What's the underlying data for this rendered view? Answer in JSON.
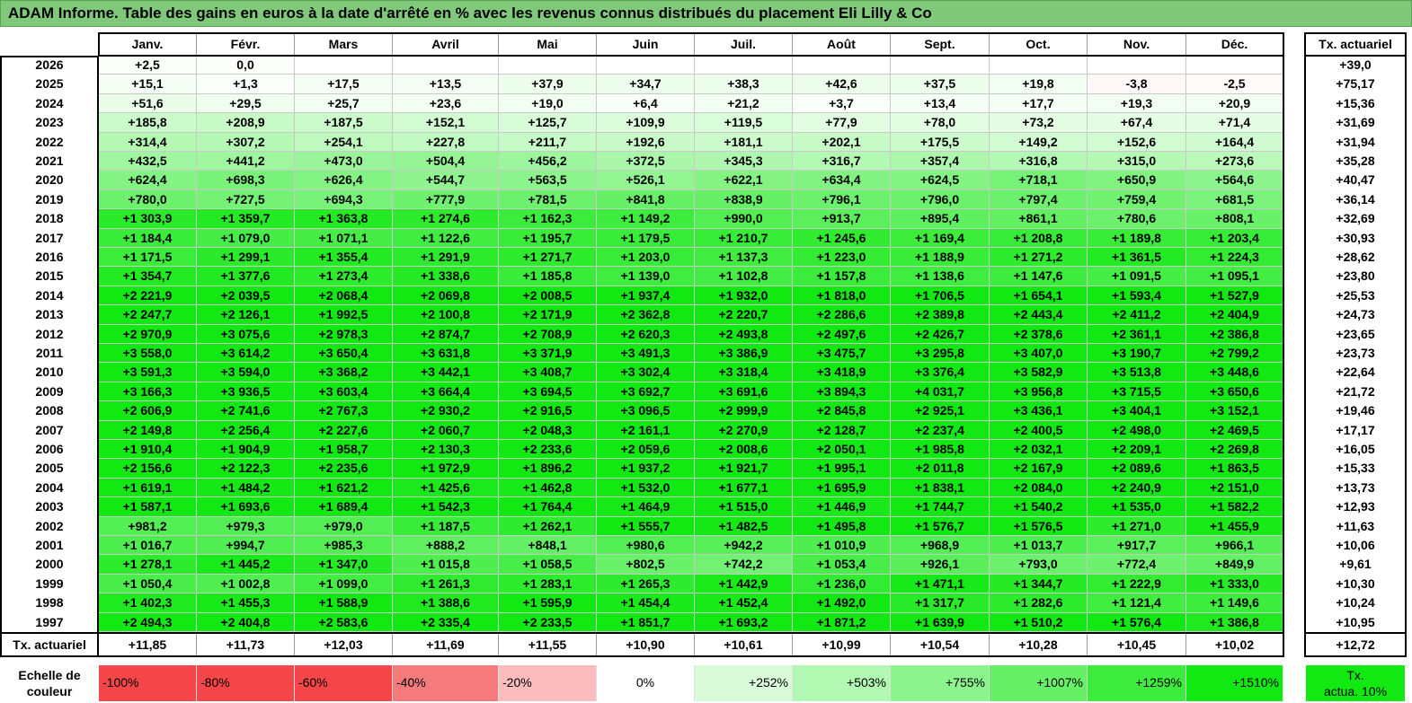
{
  "title": "ADAM Informe. Table des gains en euros à la date d'arrêté en % avec les revenus connus distribués du placement Eli Lilly & Co",
  "months": [
    "Janv.",
    "Févr.",
    "Mars",
    "Avril",
    "Mai",
    "Juin",
    "Juil.",
    "Août",
    "Sept.",
    "Oct.",
    "Nov.",
    "Déc."
  ],
  "rate_header": "Tx. actuariel",
  "rows": [
    {
      "year": "2026",
      "values": [
        "+2,5",
        "0,0",
        "",
        "",
        "",
        "",
        "",
        "",
        "",
        "",
        "",
        ""
      ],
      "rate": "+39,0"
    },
    {
      "year": "2025",
      "values": [
        "+15,1",
        "+1,3",
        "+17,5",
        "+13,5",
        "+37,9",
        "+34,7",
        "+38,3",
        "+42,6",
        "+37,5",
        "+19,8",
        "-3,8",
        "-2,5"
      ],
      "rate": "+75,17"
    },
    {
      "year": "2024",
      "values": [
        "+51,6",
        "+29,5",
        "+25,7",
        "+23,6",
        "+19,0",
        "+6,4",
        "+21,2",
        "+3,7",
        "+13,4",
        "+17,7",
        "+19,3",
        "+20,9"
      ],
      "rate": "+15,36"
    },
    {
      "year": "2023",
      "values": [
        "+185,8",
        "+208,9",
        "+187,5",
        "+152,1",
        "+125,7",
        "+109,9",
        "+119,5",
        "+77,9",
        "+78,0",
        "+73,2",
        "+67,4",
        "+71,4"
      ],
      "rate": "+31,69"
    },
    {
      "year": "2022",
      "values": [
        "+314,4",
        "+307,2",
        "+254,1",
        "+227,8",
        "+211,7",
        "+192,6",
        "+181,1",
        "+202,1",
        "+175,5",
        "+149,2",
        "+152,6",
        "+164,4"
      ],
      "rate": "+31,94"
    },
    {
      "year": "2021",
      "values": [
        "+432,5",
        "+441,2",
        "+473,0",
        "+504,4",
        "+456,2",
        "+372,5",
        "+345,3",
        "+316,7",
        "+357,4",
        "+316,8",
        "+315,0",
        "+273,6"
      ],
      "rate": "+35,28"
    },
    {
      "year": "2020",
      "values": [
        "+624,4",
        "+698,3",
        "+626,4",
        "+544,7",
        "+563,5",
        "+526,1",
        "+622,1",
        "+634,4",
        "+624,5",
        "+718,1",
        "+650,9",
        "+564,6"
      ],
      "rate": "+40,47"
    },
    {
      "year": "2019",
      "values": [
        "+780,0",
        "+727,5",
        "+694,3",
        "+777,9",
        "+781,5",
        "+841,8",
        "+838,9",
        "+796,1",
        "+796,0",
        "+797,4",
        "+759,4",
        "+681,5"
      ],
      "rate": "+36,14"
    },
    {
      "year": "2018",
      "values": [
        "+1 303,9",
        "+1 359,7",
        "+1 363,8",
        "+1 274,6",
        "+1 162,3",
        "+1 149,2",
        "+990,0",
        "+913,7",
        "+895,4",
        "+861,1",
        "+780,6",
        "+808,1"
      ],
      "rate": "+32,69"
    },
    {
      "year": "2017",
      "values": [
        "+1 184,4",
        "+1 079,0",
        "+1 071,1",
        "+1 122,6",
        "+1 195,7",
        "+1 179,5",
        "+1 210,7",
        "+1 245,6",
        "+1 169,4",
        "+1 208,8",
        "+1 189,8",
        "+1 203,4"
      ],
      "rate": "+30,93"
    },
    {
      "year": "2016",
      "values": [
        "+1 171,5",
        "+1 299,1",
        "+1 355,4",
        "+1 291,9",
        "+1 271,7",
        "+1 203,0",
        "+1 137,3",
        "+1 223,0",
        "+1 188,9",
        "+1 271,2",
        "+1 361,5",
        "+1 224,3"
      ],
      "rate": "+28,62"
    },
    {
      "year": "2015",
      "values": [
        "+1 354,7",
        "+1 377,6",
        "+1 273,4",
        "+1 338,6",
        "+1 185,8",
        "+1 139,0",
        "+1 102,8",
        "+1 157,8",
        "+1 138,6",
        "+1 147,6",
        "+1 091,5",
        "+1 095,1"
      ],
      "rate": "+23,80"
    },
    {
      "year": "2014",
      "values": [
        "+2 221,9",
        "+2 039,5",
        "+2 068,4",
        "+2 069,8",
        "+2 008,5",
        "+1 937,4",
        "+1 932,0",
        "+1 818,0",
        "+1 706,5",
        "+1 654,1",
        "+1 593,4",
        "+1 527,9"
      ],
      "rate": "+25,53"
    },
    {
      "year": "2013",
      "values": [
        "+2 247,7",
        "+2 126,1",
        "+1 992,5",
        "+2 100,8",
        "+2 171,9",
        "+2 362,8",
        "+2 220,7",
        "+2 286,6",
        "+2 389,8",
        "+2 443,4",
        "+2 411,2",
        "+2 404,9"
      ],
      "rate": "+24,73"
    },
    {
      "year": "2012",
      "values": [
        "+2 970,9",
        "+3 075,6",
        "+2 978,3",
        "+2 874,7",
        "+2 708,9",
        "+2 620,3",
        "+2 493,8",
        "+2 497,6",
        "+2 426,7",
        "+2 378,6",
        "+2 361,1",
        "+2 386,8"
      ],
      "rate": "+23,65"
    },
    {
      "year": "2011",
      "values": [
        "+3 558,0",
        "+3 614,2",
        "+3 650,4",
        "+3 631,8",
        "+3 371,9",
        "+3 491,3",
        "+3 386,9",
        "+3 475,7",
        "+3 295,8",
        "+3 407,0",
        "+3 190,7",
        "+2 799,2"
      ],
      "rate": "+23,73"
    },
    {
      "year": "2010",
      "values": [
        "+3 591,3",
        "+3 594,0",
        "+3 368,2",
        "+3 442,1",
        "+3 408,7",
        "+3 302,4",
        "+3 318,4",
        "+3 418,9",
        "+3 376,4",
        "+3 582,9",
        "+3 513,8",
        "+3 448,6"
      ],
      "rate": "+22,64"
    },
    {
      "year": "2009",
      "values": [
        "+3 166,3",
        "+3 936,5",
        "+3 603,4",
        "+3 664,4",
        "+3 694,5",
        "+3 692,7",
        "+3 691,6",
        "+3 894,3",
        "+4 031,7",
        "+3 956,8",
        "+3 715,5",
        "+3 650,6"
      ],
      "rate": "+21,72"
    },
    {
      "year": "2008",
      "values": [
        "+2 606,9",
        "+2 741,6",
        "+2 767,3",
        "+2 930,2",
        "+2 916,5",
        "+3 096,5",
        "+2 999,9",
        "+2 845,8",
        "+2 925,1",
        "+3 436,1",
        "+3 404,1",
        "+3 152,1"
      ],
      "rate": "+19,46"
    },
    {
      "year": "2007",
      "values": [
        "+2 149,8",
        "+2 256,4",
        "+2 227,6",
        "+2 060,7",
        "+2 048,3",
        "+2 161,1",
        "+2 270,9",
        "+2 128,7",
        "+2 237,4",
        "+2 400,5",
        "+2 498,0",
        "+2 469,5"
      ],
      "rate": "+17,17"
    },
    {
      "year": "2006",
      "values": [
        "+1 910,4",
        "+1 904,9",
        "+1 958,7",
        "+2 130,3",
        "+2 233,6",
        "+2 059,6",
        "+2 008,6",
        "+2 050,1",
        "+1 985,8",
        "+2 032,1",
        "+2 209,1",
        "+2 269,8"
      ],
      "rate": "+16,05"
    },
    {
      "year": "2005",
      "values": [
        "+2 156,6",
        "+2 122,3",
        "+2 235,6",
        "+1 972,9",
        "+1 896,2",
        "+1 937,2",
        "+1 921,7",
        "+1 995,1",
        "+2 011,8",
        "+2 167,9",
        "+2 089,6",
        "+1 863,5"
      ],
      "rate": "+15,33"
    },
    {
      "year": "2004",
      "values": [
        "+1 619,1",
        "+1 484,2",
        "+1 621,2",
        "+1 425,6",
        "+1 462,8",
        "+1 532,0",
        "+1 677,1",
        "+1 695,9",
        "+1 838,1",
        "+2 084,0",
        "+2 240,9",
        "+2 151,0"
      ],
      "rate": "+13,73"
    },
    {
      "year": "2003",
      "values": [
        "+1 587,1",
        "+1 693,6",
        "+1 689,4",
        "+1 542,3",
        "+1 764,4",
        "+1 464,9",
        "+1 515,0",
        "+1 446,9",
        "+1 744,7",
        "+1 540,2",
        "+1 535,0",
        "+1 582,2"
      ],
      "rate": "+12,93"
    },
    {
      "year": "2002",
      "values": [
        "+981,2",
        "+979,3",
        "+979,0",
        "+1 187,5",
        "+1 262,1",
        "+1 555,7",
        "+1 482,5",
        "+1 495,8",
        "+1 576,7",
        "+1 576,5",
        "+1 271,0",
        "+1 455,9"
      ],
      "rate": "+11,63"
    },
    {
      "year": "2001",
      "values": [
        "+1 016,7",
        "+994,7",
        "+985,3",
        "+888,2",
        "+848,1",
        "+980,6",
        "+942,2",
        "+1 010,9",
        "+968,9",
        "+1 013,7",
        "+917,7",
        "+966,1"
      ],
      "rate": "+10,06"
    },
    {
      "year": "2000",
      "values": [
        "+1 278,1",
        "+1 445,2",
        "+1 347,0",
        "+1 015,8",
        "+1 058,5",
        "+802,5",
        "+742,2",
        "+1 053,4",
        "+926,1",
        "+793,0",
        "+772,4",
        "+849,9"
      ],
      "rate": "+9,61"
    },
    {
      "year": "1999",
      "values": [
        "+1 050,4",
        "+1 002,8",
        "+1 099,0",
        "+1 261,3",
        "+1 283,1",
        "+1 265,3",
        "+1 442,9",
        "+1 236,0",
        "+1 471,1",
        "+1 344,7",
        "+1 222,9",
        "+1 333,0"
      ],
      "rate": "+10,30"
    },
    {
      "year": "1998",
      "values": [
        "+1 402,3",
        "+1 455,3",
        "+1 588,9",
        "+1 388,6",
        "+1 595,9",
        "+1 454,4",
        "+1 452,4",
        "+1 492,0",
        "+1 317,7",
        "+1 282,6",
        "+1 121,4",
        "+1 149,6"
      ],
      "rate": "+10,24"
    },
    {
      "year": "1997",
      "values": [
        "+2 494,3",
        "+2 404,8",
        "+2 583,6",
        "+2 335,4",
        "+2 233,5",
        "+1 851,7",
        "+1 693,2",
        "+1 871,2",
        "+1 639,9",
        "+1 510,2",
        "+1 576,4",
        "+1 386,8"
      ],
      "rate": "+10,95"
    }
  ],
  "footer": {
    "label": "Tx. actuariel",
    "values": [
      "+11,85",
      "+11,73",
      "+12,03",
      "+11,69",
      "+11,55",
      "+10,90",
      "+10,61",
      "+10,99",
      "+10,54",
      "+10,28",
      "+10,45",
      "+10,02"
    ],
    "rate": "+12,72"
  },
  "scale": {
    "label_line1": "Echelle de",
    "label_line2": "couleur",
    "items": [
      "-100%",
      "-80%",
      "-60%",
      "-40%",
      "-20%",
      "0%",
      "+252%",
      "+503%",
      "+755%",
      "+1007%",
      "+1259%",
      "+1510%"
    ],
    "colors": [
      "#f5474a",
      "#f5474a",
      "#f5474a",
      "#f57a7c",
      "#fbbcbd",
      "#ffffff",
      "#d9fbd9",
      "#b2f7b2",
      "#8cf48c",
      "#65f065",
      "#3eec3e",
      "#12e812"
    ],
    "rate_line1": "Tx.",
    "rate_line2": "actua. 10%",
    "rate_color": "#12e812"
  }
}
